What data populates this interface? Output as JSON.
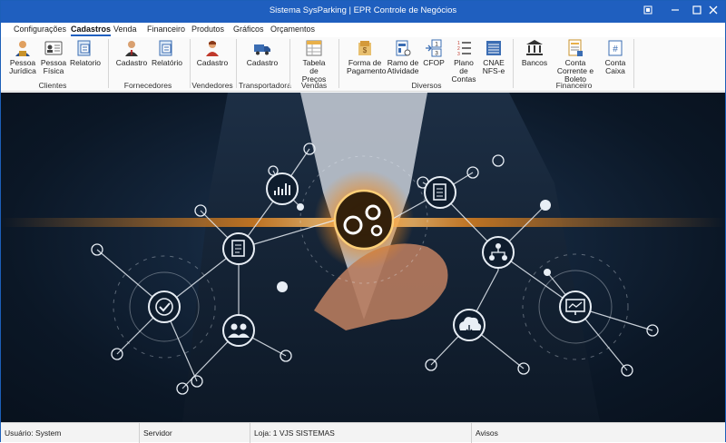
{
  "window": {
    "title": "Sistema SysParking | EPR Controle de Negócios"
  },
  "menu": {
    "tabs": [
      "Configurações",
      "Cadastros",
      "Venda",
      "Financeiro",
      "Produtos",
      "Gráficos",
      "Orçamentos"
    ],
    "active": "Cadastros"
  },
  "ribbon": {
    "clientes": {
      "label": "Clientes",
      "buttons": [
        "Pessoa Jurídica",
        "Pessoa Física",
        "Relatorio"
      ]
    },
    "fornecedores": {
      "label": "Fornecedores",
      "buttons": [
        "Cadastro",
        "Relatório"
      ]
    },
    "vendedores": {
      "label": "Vendedores",
      "buttons": [
        "Cadastro"
      ]
    },
    "transportadora": {
      "label": "Transportadora",
      "buttons": [
        "Cadastro"
      ]
    },
    "vendas": {
      "label": "Vendas",
      "buttons": [
        "Tabela de Preços"
      ]
    },
    "diversos": {
      "label": "Diversos",
      "buttons": [
        "Forma de Pagamento",
        "Ramo de Atividade",
        "CFOP",
        "Plano de Contas",
        "CNAE NFS-e"
      ]
    },
    "financeiro": {
      "label": "Financeiro",
      "buttons": [
        "Bancos",
        "Conta Corrente e Boleto",
        "Conta Caixa"
      ]
    }
  },
  "cfop_icon_text": [
    "1",
    "3"
  ],
  "statusbar": {
    "usuario": "Usuário: System",
    "servidor": "Servidor",
    "loja": "Loja: 1 VJS SISTEMAS",
    "avisos": "Avisos"
  },
  "colors": {
    "titlebar": "#1f5fbf",
    "accent": "#f08a1c",
    "network": "#e8eef5"
  }
}
